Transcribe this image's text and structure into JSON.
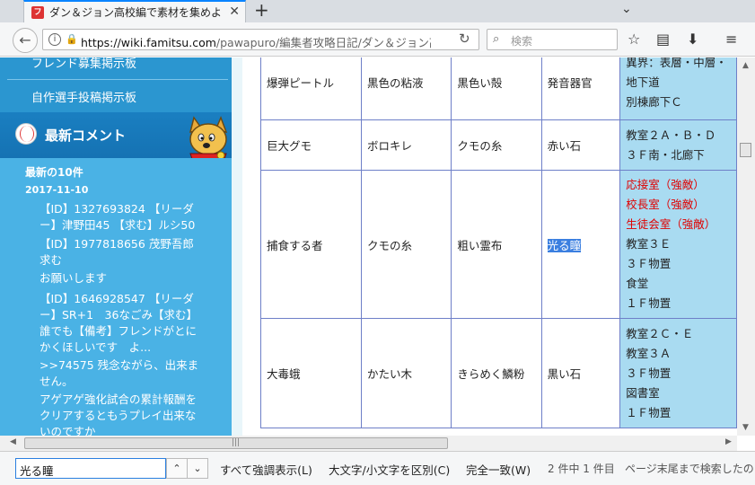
{
  "browser": {
    "tab_title": "ダン＆ジョン高校編で素材を集めよ",
    "tab_favicon": "ファ",
    "url_domain": "https://wiki.famitsu.com",
    "url_rest": "/pawapuro/編集者攻略日記/ダン＆ジョン高",
    "search_placeholder": "検索",
    "icons": [
      "back-icon",
      "info-icon",
      "lock-icon",
      "reload-icon",
      "search-icon",
      "bookmark-star-icon",
      "reader-icon",
      "download-icon",
      "menu-icon"
    ]
  },
  "sidebar": {
    "links": [
      "フレンド募集掲示板",
      "自作選手投稿掲示板"
    ],
    "section_title": "最新コメント",
    "subheading": "最新の10件",
    "date": "2017-11-10",
    "comments": [
      "【ID】1327693824 【リーダー】津野田45 【求む】ルシ50",
      "【ID】1977818656 茂野吾郎求む",
      "お願いします",
      "【ID】1646928547 【リーダー】SR+1　36なごみ【求む】誰でも【備考】フレンドがとにかくほしいです　よ...",
      ">>74575 残念ながら、出来ません。",
      "アゲアゲ強化試合の累計報酬をクリアするともうプレイ出来ないのですか"
    ]
  },
  "table": {
    "rows": [
      {
        "c1": "爆弾ピートル",
        "c2": "黒色の粘液",
        "c3": "黒色い殻",
        "c4": "発音器官",
        "places": [
          {
            "t": "異界：表層・中層・",
            "red": false
          },
          {
            "t": "地下道",
            "red": false
          },
          {
            "t": "別棟廊下Ｃ",
            "red": false
          }
        ]
      },
      {
        "c1": "巨大グモ",
        "c2": "ボロキレ",
        "c3": "クモの糸",
        "c4": "赤い石",
        "places": [
          {
            "t": "教室２Ａ・Ｂ・Ｄ",
            "red": false
          },
          {
            "t": "３Ｆ南・北廊下",
            "red": false
          }
        ]
      },
      {
        "c1": "捕食する者",
        "c2": "クモの糸",
        "c3": "粗い霊布",
        "c4": "光る瞳",
        "c4_highlight": true,
        "places": [
          {
            "t": "応接室（強敵）",
            "red": true
          },
          {
            "t": "校長室（強敵）",
            "red": true
          },
          {
            "t": "生徒会室（強敵）",
            "red": true
          },
          {
            "t": "教室３Ｅ",
            "red": false
          },
          {
            "t": "３Ｆ物置",
            "red": false
          },
          {
            "t": "食堂",
            "red": false
          },
          {
            "t": "１Ｆ物置",
            "red": false
          }
        ]
      },
      {
        "c1": "大毒蛾",
        "c2": "かたい木",
        "c3": "きらめく鱗粉",
        "c4": "黒い石",
        "places": [
          {
            "t": "教室２Ｃ・Ｅ",
            "red": false
          },
          {
            "t": "教室３Ａ",
            "red": false
          },
          {
            "t": "３Ｆ物置",
            "red": false
          },
          {
            "t": "図書室",
            "red": false
          },
          {
            "t": "１Ｆ物置",
            "red": false
          }
        ]
      }
    ]
  },
  "findbar": {
    "query": "光る瞳",
    "highlight_all": "すべて強調表示(L)",
    "match_case": "大文字/小文字を区別(C)",
    "whole_word": "完全一致(W)",
    "status": "2 件中 1 件目",
    "end_message": "ページ末尾まで検索したの"
  },
  "colors": {
    "sidebar_blue": "#2b96d0",
    "place_cell": "#a9dbf1",
    "table_border": "#6e7fc8",
    "highlight": "#3b7fe0",
    "red_text": "#e00000"
  }
}
